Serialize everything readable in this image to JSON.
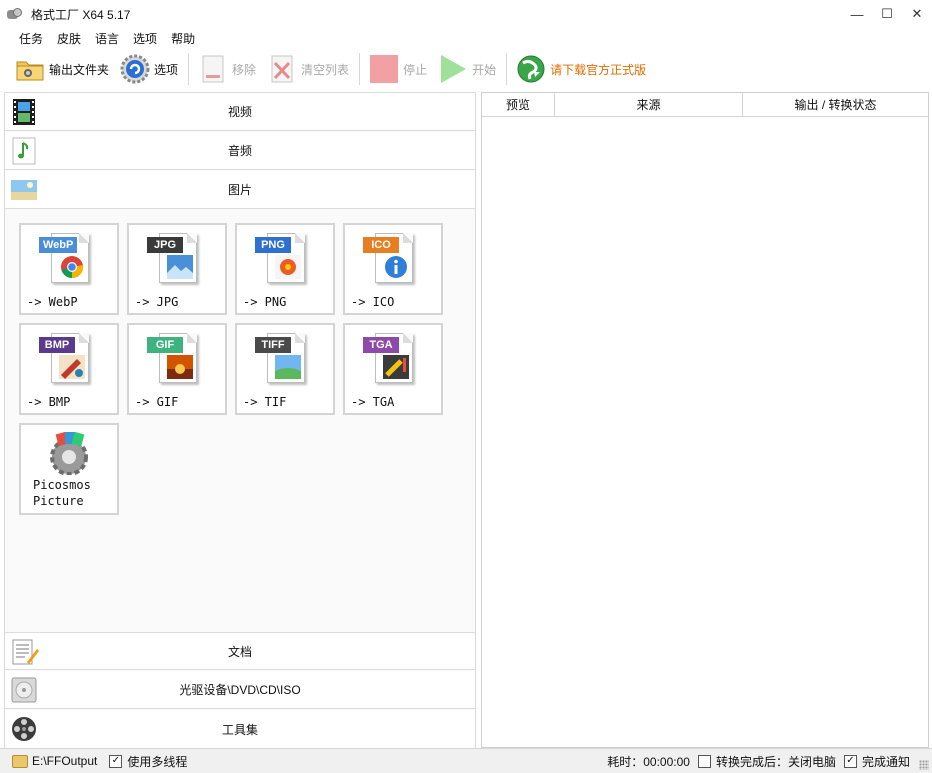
{
  "window": {
    "title": "格式工厂 X64 5.17"
  },
  "menu": [
    "任务",
    "皮肤",
    "语言",
    "选项",
    "帮助"
  ],
  "toolbar": {
    "output_folder": "输出文件夹",
    "options": "选项",
    "remove": "移除",
    "clear_list": "清空列表",
    "stop": "停止",
    "start": "开始",
    "download": "请下载官方正式版"
  },
  "categories": {
    "video": "视频",
    "audio": "音频",
    "image": "图片",
    "document": "文档",
    "rom": "光驱设备\\DVD\\CD\\ISO",
    "tools": "工具集"
  },
  "tiles": [
    {
      "badge": "WebP",
      "label": "-> WebP",
      "color": "#4a8ed9"
    },
    {
      "badge": "JPG",
      "label": "-> JPG",
      "color": "#3a3a3a"
    },
    {
      "badge": "PNG",
      "label": "-> PNG",
      "color": "#2e6fd0"
    },
    {
      "badge": "ICO",
      "label": "-> ICO",
      "color": "#e67e22"
    },
    {
      "badge": "BMP",
      "label": "-> BMP",
      "color": "#5b3a8e"
    },
    {
      "badge": "GIF",
      "label": "-> GIF",
      "color": "#3fb37f"
    },
    {
      "badge": "TIFF",
      "label": "-> TIF",
      "color": "#4a4a4a"
    },
    {
      "badge": "TGA",
      "label": "-> TGA",
      "color": "#8e4aa8"
    }
  ],
  "picosmos": {
    "line1": "Picosmos",
    "line2": "Picture"
  },
  "table": {
    "headers": [
      "预览",
      "来源",
      "输出 / 转换状态"
    ]
  },
  "status": {
    "output_path": "E:\\FFOutput",
    "multithread": "使用多线程",
    "elapsed": "耗时：00:00:00",
    "after_convert": "转换完成后：关闭电脑",
    "notify": "完成通知"
  }
}
